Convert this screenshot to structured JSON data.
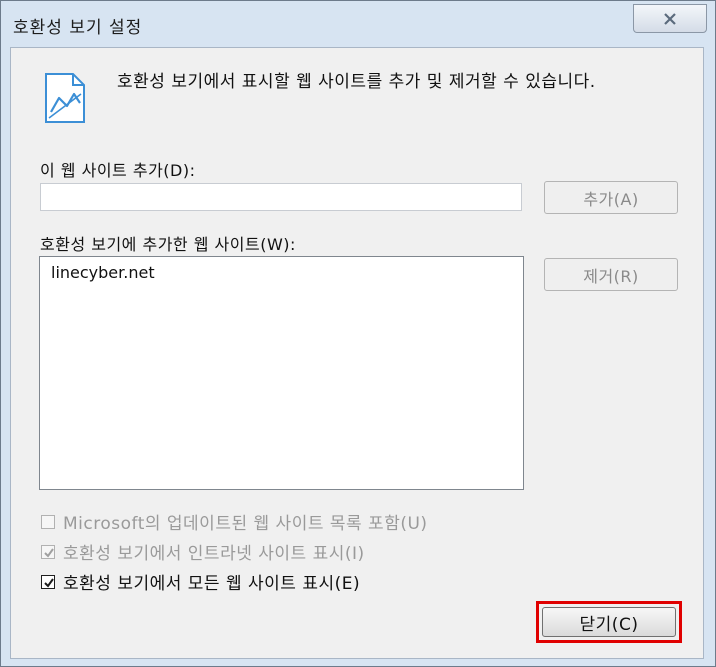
{
  "window": {
    "title": "호환성 보기 설정"
  },
  "dialog": {
    "description": "호환성 보기에서 표시할 웹 사이트를 추가 및 제거할 수 있습니다.",
    "add_site": {
      "label": "이 웹 사이트 추가(D):",
      "value": "",
      "button": "추가(A)"
    },
    "added_sites": {
      "label": "호환성 보기에 추가한 웹 사이트(W):",
      "items": [
        "linecyber.net"
      ],
      "remove_button": "제거(R)"
    },
    "checkboxes": [
      {
        "label": "Microsoft의 업데이트된 웹 사이트 목록 포함(U)",
        "checked": false,
        "enabled": false
      },
      {
        "label": "호환성 보기에서 인트라넷 사이트 표시(I)",
        "checked": true,
        "enabled": false
      },
      {
        "label": "호환성 보기에서 모든 웹 사이트 표시(E)",
        "checked": true,
        "enabled": true
      }
    ],
    "close_button": "닫기(C)"
  },
  "icons": {
    "close": "close-icon",
    "page": "broken-page-icon",
    "check": "checkmark-icon"
  },
  "colors": {
    "highlight": "#e00000",
    "titlebar": "#d7e4f2",
    "icon": "#3c8fd6"
  }
}
